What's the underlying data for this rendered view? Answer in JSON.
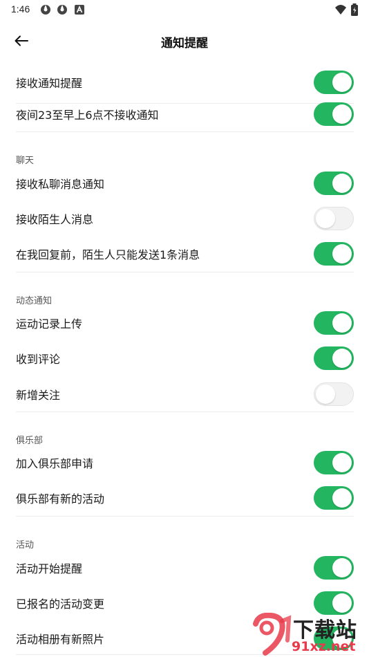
{
  "status_bar": {
    "time": "1:46"
  },
  "header": {
    "title": "通知提醒"
  },
  "general": [
    {
      "label": "接收通知提醒",
      "on": true
    },
    {
      "label": "夜间23至早上6点不接收通知",
      "on": true
    }
  ],
  "sections": [
    {
      "title": "聊天",
      "items": [
        {
          "label": "接收私聊消息通知",
          "on": true
        },
        {
          "label": "接收陌生人消息",
          "on": false
        },
        {
          "label": "在我回复前，陌生人只能发送1条消息",
          "on": true
        }
      ]
    },
    {
      "title": "动态通知",
      "items": [
        {
          "label": "运动记录上传",
          "on": true
        },
        {
          "label": "收到评论",
          "on": true
        },
        {
          "label": "新增关注",
          "on": false
        }
      ]
    },
    {
      "title": "俱乐部",
      "items": [
        {
          "label": "加入俱乐部申请",
          "on": true
        },
        {
          "label": "俱乐部有新的活动",
          "on": true
        }
      ]
    },
    {
      "title": "活动",
      "items": [
        {
          "label": "活动开始提醒",
          "on": true
        },
        {
          "label": "已报名的活动变更",
          "on": true
        },
        {
          "label": "活动相册有新照片",
          "on": true
        }
      ]
    }
  ],
  "watermark": {
    "brand": "下载站",
    "domain": "91xz.net"
  },
  "colors": {
    "toggle_on": "#23b55f",
    "toggle_off": "#f2f2f2"
  }
}
